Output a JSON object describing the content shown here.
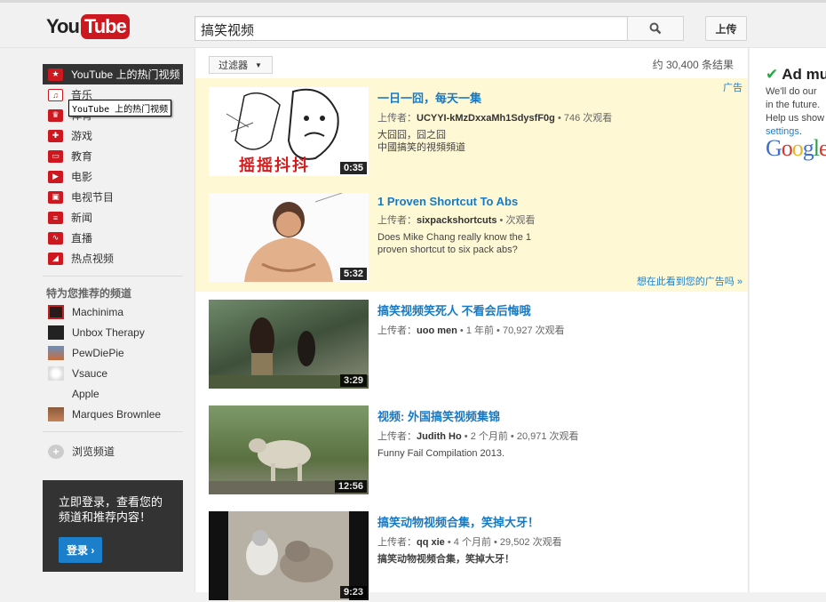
{
  "header": {
    "logo_you": "You",
    "logo_tube": "Tube",
    "search_value": "搞笑视频",
    "upload_label": "上传"
  },
  "guide": {
    "items": [
      {
        "label": "YouTube 上的热门视频",
        "icon": "youtube-popular-icon"
      },
      {
        "label": "音乐",
        "icon": "headphones-icon"
      },
      {
        "label": "体育",
        "icon": "trophy-icon"
      },
      {
        "label": "游戏",
        "icon": "gamepad-icon"
      },
      {
        "label": "教育",
        "icon": "book-icon"
      },
      {
        "label": "电影",
        "icon": "film-icon"
      },
      {
        "label": "电视节目",
        "icon": "tv-icon"
      },
      {
        "label": "新闻",
        "icon": "newspaper-icon"
      },
      {
        "label": "直播",
        "icon": "live-icon"
      },
      {
        "label": "热点视频",
        "icon": "flame-icon"
      }
    ],
    "tooltip": "YouTube 上的热门视频",
    "recommended_heading": "特为您推荐的频道",
    "channels": [
      {
        "label": "Machinima"
      },
      {
        "label": "Unbox Therapy"
      },
      {
        "label": "PewDiePie"
      },
      {
        "label": "Vsauce"
      },
      {
        "label": "Apple"
      },
      {
        "label": "Marques Brownlee"
      }
    ],
    "browse_label": "浏览频道",
    "signin_text": "立即登录，查看您的频道和推荐内容！",
    "signin_button": "登录 ›"
  },
  "results_bar": {
    "filter_label": "过滤器",
    "count": "约 30,400 条结果"
  },
  "ads": {
    "tag": "广告",
    "why_link": "想在此看到您的广告吗 »"
  },
  "results": [
    {
      "title": "一日一囧，每天一集",
      "uploader_prefix": "上传者：",
      "uploader": "UCYYI-kMzDxxaMh1SdysfF0g",
      "stats": "• 746 次观看",
      "desc_line1": "大囧囧，囧之囧",
      "desc_line2": "中國搞笑的視頻頻道",
      "duration": "0:35",
      "thumb_caption": "摇摇抖抖"
    },
    {
      "title": "1 Proven Shortcut To Abs",
      "uploader_prefix": "上传者：",
      "uploader": "sixpackshortcuts",
      "stats": "• 次观看",
      "desc_line1": "Does Mike Chang really know the 1",
      "desc_line2": "proven shortcut to six pack abs?",
      "duration": "5:32"
    },
    {
      "title": "搞笑视频笑死人 不看会后悔哦",
      "uploader_prefix": "上传者：",
      "uploader": "uoo men",
      "stats": "• 1 年前 • 70,927 次观看",
      "desc_line1": "",
      "desc_line2": "",
      "duration": "3:29"
    },
    {
      "title": "视频: 外国搞笑视频集锦",
      "uploader_prefix": "上传者：",
      "uploader": "Judith Ho",
      "stats": "• 2 个月前 • 20,971 次观看",
      "desc_line1": "Funny Fail Compilation 2013.",
      "desc_line2": "",
      "duration": "12:56"
    },
    {
      "title": "搞笑动物视频合集，笑掉大牙！",
      "uploader_prefix": "上传者：",
      "uploader": "qq xie",
      "stats": "• 4 个月前 • 29,502 次观看",
      "desc_line1": "搞笑动物视频合集，笑掉大牙！",
      "desc_line2": "",
      "duration": "9:23"
    }
  ],
  "right_ad": {
    "heading": "Ad mu",
    "line1": "We'll do our",
    "line2": "in the future.",
    "line3": "Help us show",
    "link": "settings",
    "google": "Google"
  },
  "colors": {
    "brand_red": "#cc181e",
    "link_blue": "#167ac6",
    "ad_bg": "#fff8d5"
  }
}
